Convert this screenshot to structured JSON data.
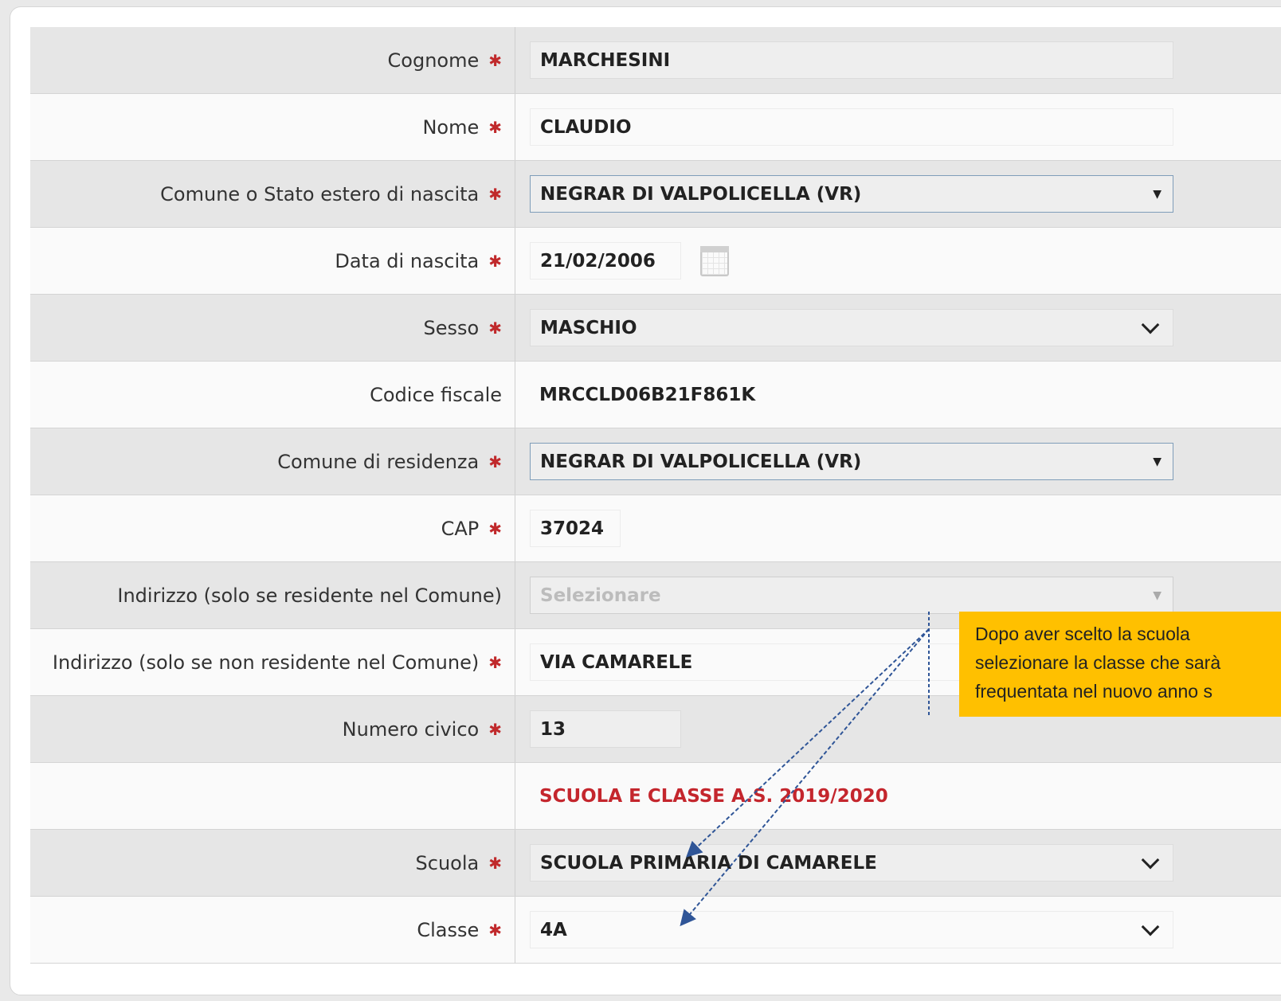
{
  "form": {
    "cognome": {
      "label": "Cognome",
      "value": "MARCHESINI"
    },
    "nome": {
      "label": "Nome",
      "value": "CLAUDIO"
    },
    "comune_nascita": {
      "label": "Comune o Stato estero di nascita",
      "value": "NEGRAR DI VALPOLICELLA (VR)"
    },
    "data_nascita": {
      "label": "Data di nascita",
      "value": "21/02/2006"
    },
    "sesso": {
      "label": "Sesso",
      "value": "MASCHIO"
    },
    "codice_fiscale": {
      "label": "Codice fiscale",
      "value": "MRCCLD06B21F861K"
    },
    "comune_residenza": {
      "label": "Comune di residenza",
      "value": "NEGRAR DI VALPOLICELLA (VR)"
    },
    "cap": {
      "label": "CAP",
      "value": "37024"
    },
    "indirizzo_residente": {
      "label": "Indirizzo (solo se residente nel Comune)",
      "placeholder": "Selezionare"
    },
    "indirizzo_non_residente": {
      "label": "Indirizzo (solo se non residente nel Comune)",
      "value": "VIA CAMARELE"
    },
    "numero_civico": {
      "label": "Numero civico",
      "value": "13"
    },
    "section_title": "SCUOLA E CLASSE A.S. 2019/2020",
    "scuola": {
      "label": "Scuola",
      "value": "SCUOLA PRIMARIA DI CAMARELE"
    },
    "classe": {
      "label": "Classe",
      "value": "4A"
    }
  },
  "annotation": {
    "lines": [
      "Dopo aver scelto la scuola",
      "selezionare la classe che sarà",
      "frequentata nel nuovo anno s"
    ]
  },
  "colors": {
    "required": "#c0292b",
    "section_title": "#c4262d",
    "note_bg": "#ffc000",
    "arrow": "#2f5597"
  }
}
